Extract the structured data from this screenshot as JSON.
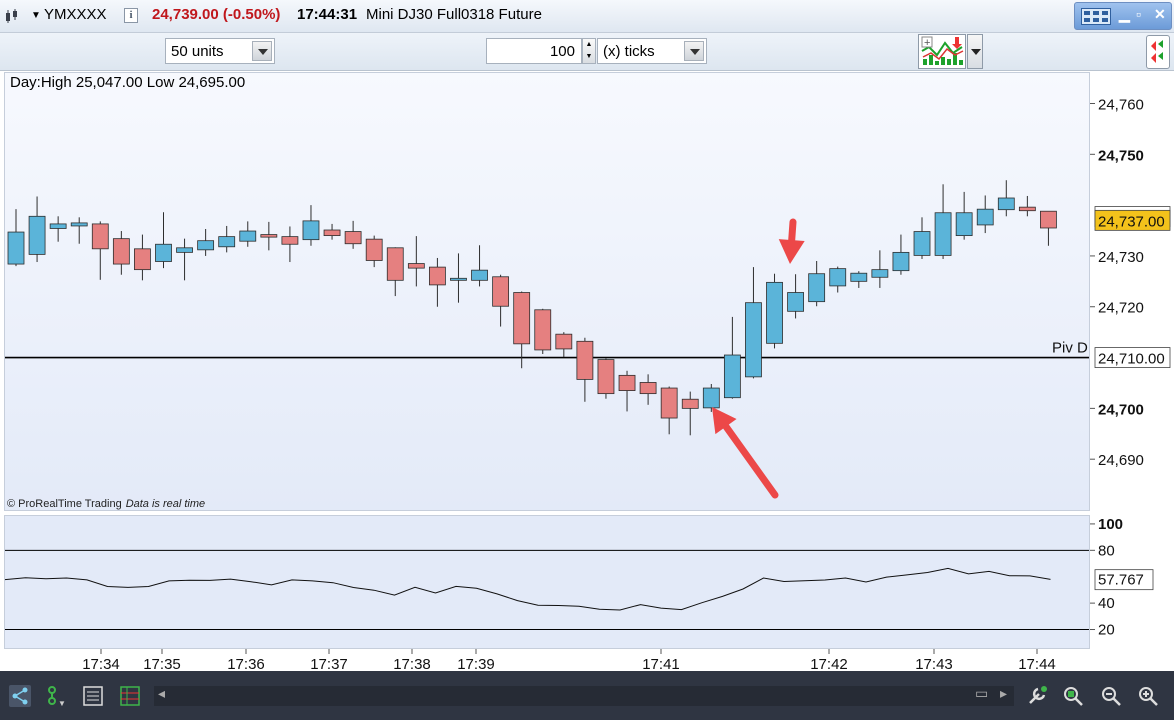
{
  "header": {
    "symbol": "YMXXXX",
    "price_change": "24,739.00 (-0.50%)",
    "clock": "17:44:31",
    "instrument": "Mini DJ30 Full0318 Future",
    "price_color": "#c0171c"
  },
  "toolbar": {
    "units_select": "50 units",
    "tick_count": "100",
    "tick_unit_select": "(x) ticks"
  },
  "chart_info": {
    "day_high_low": "Day:High 25,047.00 Low 24,695.00",
    "credit": "© ProRealTime Trading",
    "realtime_note": "Data is real time",
    "pivot_label": "Piv D"
  },
  "colors": {
    "up_candle": "#5bb4d9",
    "down_candle": "#e58080",
    "last_price_bg": "#f3c21b",
    "annotation_arrow": "#ec4848"
  },
  "chart_data": [
    {
      "type": "candlestick",
      "ylim": [
        24680,
        24766
      ],
      "y_ticks": [
        "24,760",
        "24,750",
        "24,730",
        "24,720",
        "24,700",
        "24,690"
      ],
      "bold_ticks": [
        "24,750",
        "24,700"
      ],
      "price_labels": [
        {
          "label": "24,737.75",
          "value": 24737.75,
          "style": "outline"
        },
        {
          "label": "24,737.00",
          "value": 24737.0,
          "style": "last"
        },
        {
          "label": "24,710.00",
          "value": 24710.0,
          "style": "outline"
        }
      ],
      "hline": {
        "name": "Piv D",
        "value": 24710.0
      },
      "candles": [
        {
          "o": 24728.4,
          "h": 24739.2,
          "l": 24728.0,
          "c": 24734.7
        },
        {
          "o": 24730.3,
          "h": 24741.7,
          "l": 24728.8,
          "c": 24737.8
        },
        {
          "o": 24735.4,
          "h": 24737.8,
          "l": 24732.8,
          "c": 24736.3
        },
        {
          "o": 24735.9,
          "h": 24737.6,
          "l": 24732.4,
          "c": 24736.5
        },
        {
          "o": 24736.3,
          "h": 24736.8,
          "l": 24725.3,
          "c": 24731.4
        },
        {
          "o": 24733.4,
          "h": 24734.9,
          "l": 24726.3,
          "c": 24728.4
        },
        {
          "o": 24731.4,
          "h": 24734.2,
          "l": 24725.2,
          "c": 24727.3
        },
        {
          "o": 24728.9,
          "h": 24738.6,
          "l": 24727.6,
          "c": 24732.3
        },
        {
          "o": 24730.7,
          "h": 24733.4,
          "l": 24725.2,
          "c": 24731.6
        },
        {
          "o": 24731.2,
          "h": 24735.3,
          "l": 24730.0,
          "c": 24733.0
        },
        {
          "o": 24731.8,
          "h": 24735.9,
          "l": 24730.7,
          "c": 24733.8
        },
        {
          "o": 24732.9,
          "h": 24736.8,
          "l": 24731.8,
          "c": 24734.9
        },
        {
          "o": 24734.2,
          "h": 24736.7,
          "l": 24731.1,
          "c": 24733.7
        },
        {
          "o": 24733.8,
          "h": 24735.8,
          "l": 24728.8,
          "c": 24732.3
        },
        {
          "o": 24733.2,
          "h": 24740.0,
          "l": 24732.0,
          "c": 24736.9
        },
        {
          "o": 24735.1,
          "h": 24736.3,
          "l": 24733.2,
          "c": 24734.0
        },
        {
          "o": 24734.8,
          "h": 24736.9,
          "l": 24731.4,
          "c": 24732.4
        },
        {
          "o": 24733.3,
          "h": 24734.0,
          "l": 24727.8,
          "c": 24729.1
        },
        {
          "o": 24731.6,
          "h": 24731.7,
          "l": 24722.1,
          "c": 24725.2
        },
        {
          "o": 24728.5,
          "h": 24733.9,
          "l": 24724.0,
          "c": 24727.6
        },
        {
          "o": 24727.8,
          "h": 24729.6,
          "l": 24720.0,
          "c": 24724.3
        },
        {
          "o": 24725.2,
          "h": 24730.5,
          "l": 24720.8,
          "c": 24725.6
        },
        {
          "o": 24725.2,
          "h": 24732.1,
          "l": 24724.0,
          "c": 24727.2
        },
        {
          "o": 24725.9,
          "h": 24726.3,
          "l": 24716.1,
          "c": 24720.1
        },
        {
          "o": 24722.8,
          "h": 24723.0,
          "l": 24707.9,
          "c": 24712.7
        },
        {
          "o": 24719.4,
          "h": 24719.6,
          "l": 24710.7,
          "c": 24711.5
        },
        {
          "o": 24714.6,
          "h": 24715.0,
          "l": 24710.1,
          "c": 24711.7
        },
        {
          "o": 24713.2,
          "h": 24713.9,
          "l": 24701.3,
          "c": 24705.7
        },
        {
          "o": 24709.6,
          "h": 24709.8,
          "l": 24701.9,
          "c": 24702.9
        },
        {
          "o": 24706.5,
          "h": 24707.4,
          "l": 24699.4,
          "c": 24703.5
        },
        {
          "o": 24705.1,
          "h": 24706.7,
          "l": 24700.7,
          "c": 24702.9
        },
        {
          "o": 24704.0,
          "h": 24704.3,
          "l": 24694.9,
          "c": 24698.1
        },
        {
          "o": 24701.8,
          "h": 24703.3,
          "l": 24694.7,
          "c": 24700.0
        },
        {
          "o": 24700.1,
          "h": 24704.8,
          "l": 24699.3,
          "c": 24704.0
        },
        {
          "o": 24702.1,
          "h": 24718.0,
          "l": 24701.9,
          "c": 24710.5
        },
        {
          "o": 24706.2,
          "h": 24727.8,
          "l": 24705.9,
          "c": 24720.8
        },
        {
          "o": 24712.8,
          "h": 24726.5,
          "l": 24711.8,
          "c": 24724.8
        },
        {
          "o": 24719.1,
          "h": 24726.4,
          "l": 24717.7,
          "c": 24722.8
        },
        {
          "o": 24721.0,
          "h": 24729.0,
          "l": 24720.1,
          "c": 24726.5
        },
        {
          "o": 24724.1,
          "h": 24727.9,
          "l": 24722.8,
          "c": 24727.5
        },
        {
          "o": 24725.0,
          "h": 24727.0,
          "l": 24723.7,
          "c": 24726.6
        },
        {
          "o": 24725.8,
          "h": 24731.1,
          "l": 24723.7,
          "c": 24727.3
        },
        {
          "o": 24727.1,
          "h": 24734.2,
          "l": 24726.3,
          "c": 24730.7
        },
        {
          "o": 24730.1,
          "h": 24737.6,
          "l": 24729.4,
          "c": 24734.8
        },
        {
          "o": 24730.1,
          "h": 24744.1,
          "l": 24729.4,
          "c": 24738.5
        },
        {
          "o": 24734.0,
          "h": 24742.6,
          "l": 24733.2,
          "c": 24738.5
        },
        {
          "o": 24736.1,
          "h": 24741.9,
          "l": 24734.5,
          "c": 24739.2
        },
        {
          "o": 24739.1,
          "h": 24744.9,
          "l": 24737.8,
          "c": 24741.4
        },
        {
          "o": 24739.6,
          "h": 24741.8,
          "l": 24737.8,
          "c": 24738.9
        },
        {
          "o": 24738.8,
          "h": 24738.8,
          "l": 24732.0,
          "c": 24735.5
        }
      ]
    },
    {
      "type": "line",
      "ylim": [
        6,
        106
      ],
      "y_ticks": [
        "100",
        "80",
        "57.767",
        "40",
        "20"
      ],
      "bold_ticks": [
        "100"
      ],
      "hlines": [
        80,
        20
      ],
      "last_value": 57.767,
      "values": [
        57.8,
        59.2,
        58.5,
        59.0,
        57.6,
        52.6,
        51.9,
        52.6,
        56.8,
        57.4,
        57.2,
        58.2,
        56.2,
        53.8,
        57.6,
        56.8,
        55.5,
        51.8,
        49.8,
        46.1,
        52.0,
        47.7,
        52.7,
        51.2,
        47.0,
        41.9,
        38.4,
        38.2,
        37.7,
        35.4,
        34.8,
        38.9,
        36.2,
        35.1,
        40.3,
        45.1,
        50.7,
        59.0,
        56.4,
        57.0,
        57.5,
        59.0,
        56.0,
        59.7,
        61.4,
        63.2,
        66.3,
        62.1,
        64.0,
        60.8,
        60.6,
        58.0
      ]
    }
  ],
  "time_axis": {
    "labels": [
      "17:34",
      "17:35",
      "17:36",
      "17:37",
      "17:38",
      "17:39",
      "17:41",
      "17:42",
      "17:43",
      "17:44"
    ]
  }
}
